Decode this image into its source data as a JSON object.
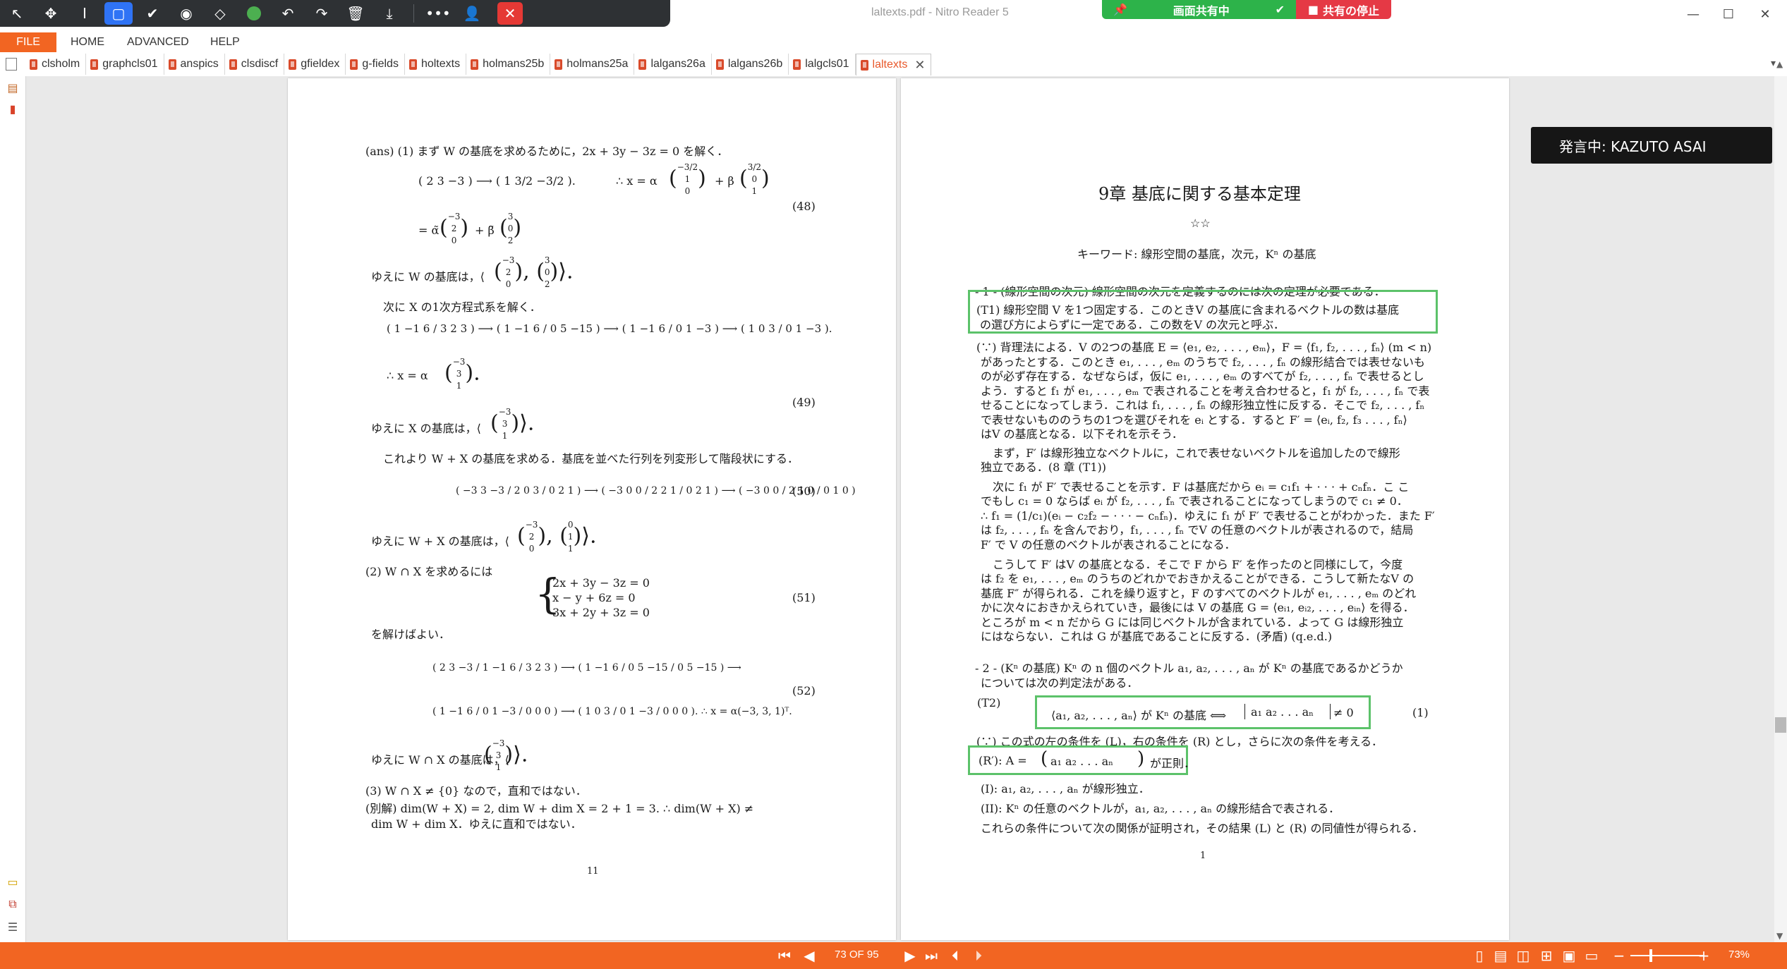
{
  "window": {
    "title": "laltexts.pdf - Nitro Reader 5",
    "share_status": "画面共有中",
    "share_stop": "共有の停止",
    "minimize": "—",
    "maximize": "☐",
    "close": "✕"
  },
  "menu": {
    "items": [
      "FILE",
      "HOME",
      "ADVANCED",
      "HELP"
    ]
  },
  "tabs": [
    {
      "label": "clsholm"
    },
    {
      "label": "graphcls01"
    },
    {
      "label": "anspics"
    },
    {
      "label": "clsdiscf"
    },
    {
      "label": "gfieldex"
    },
    {
      "label": "g-fields"
    },
    {
      "label": "holtexts"
    },
    {
      "label": "holmans25b"
    },
    {
      "label": "holmans25a"
    },
    {
      "label": "lalgans26a"
    },
    {
      "label": "lalgans26b"
    },
    {
      "label": "lalgcls01"
    },
    {
      "label": "laltexts",
      "active": true
    }
  ],
  "speaking_badge": "発言中: KAZUTO ASAI",
  "left_page": {
    "l1": "(ans) (1) まず W の基底を求めるために，2x + 3y − 3z = 0 を解く．",
    "l2a": "( 2  3  −3 ) ⟶ ( 1  3/2  −3/2 ).",
    "l2b": "∴  x = α",
    "l2c": "+ β",
    "eq48": "(48)",
    "l3": "= α̃",
    "l3b": "+ β̃",
    "l4": "ゆえに W の基底は，⟨",
    "l5": "次に X の1次方程式系を解く．",
    "l6": "∴  x = α",
    "eq49": "(49)",
    "l7": "ゆえに X の基底は，⟨",
    "l8": "これより W + X の基底を求める．基底を並べた行列を列変形して階段状にする．",
    "eq50": "(50)",
    "l9": "ゆえに W + X の基底は，⟨",
    "l10": "(2) W ∩ X を求めるには",
    "sys1": "2x + 3y − 3z = 0",
    "sys2": "x − y + 6z = 0",
    "sys3": "3x + 2y + 3z = 0",
    "eq51": "(51)",
    "l11": "を解けばよい．",
    "eq52": "(52)",
    "l12": "ゆえに W ∩ X の基底は，⟨",
    "l13": "(3) W ∩ X ≠ {0} なので，直和ではない．",
    "l14": "(別解) dim(W + X) = 2,  dim W + dim X = 2 + 1 = 3.    ∴  dim(W + X) ≠",
    "l15": "dim W + dim X．ゆえに直和ではない．",
    "page_no": "11"
  },
  "right_page": {
    "chapter": "9章  基底に関する基本定理",
    "stars": "☆☆",
    "keywords": "キーワード: 線形空間の基底，次元，Kⁿ の基底",
    "sec1": "- 1 - (線形空間の次元) 線形空間の次元を定義するのには次の定理が必要である．",
    "t1a": "(T1) 線形空間 V を1つ固定する．このときV の基底に含まれるベクトルの数は基底",
    "t1b": "の選び方によらずに一定である．この数をV の次元と呼ぶ．",
    "p1": "(∵) 背理法による．V の2つの基底 E = ⟨e₁, e₂, . . . , eₘ⟩，F = ⟨f₁, f₂, . . . , fₙ⟩ (m < n)",
    "p2": "があったとする．このとき e₁, . . . , eₘ のうちで f₂, . . . , fₙ の線形結合では表せないも",
    "p3": "のが必ず存在する．なぜならば，仮に e₁, . . . , eₘ のすべてが f₂, . . . , fₙ で表せるとし",
    "p4": "よう．すると f₁ が e₁, . . . , eₘ で表されることを考え合わせると，f₁ が f₂, . . . , fₙ で表",
    "p5": "せることになってしまう．これは f₁, . . . , fₙ の線形独立性に反する．そこで f₂, . . . , fₙ",
    "p6": "で表せないもののうちの1つを選びそれを eᵢ とする．すると F′ = ⟨eᵢ, f₂, f₃ . . . , fₙ⟩",
    "p7": "はV の基底となる．以下それを示そう．",
    "p8": "まず，F′ は線形独立なベクトルに，これで表せないベクトルを追加したので線形",
    "p9": "独立である．(8 章 (T1))",
    "p10": "次に f₁ が F′ で表せることを示す．F は基底だから eᵢ = c₁f₁ + · · · + cₙfₙ．こ こ",
    "p11": "でもし c₁ = 0 ならば eᵢ が f₂, . . . , fₙ で表されることになってしまうので c₁ ≠ 0．",
    "p12": "∴ f₁ = (1/c₁)(eᵢ − c₂f₂ − · · · − cₙfₙ)．ゆえに f₁ が F′ で表せることがわかった．また F′",
    "p13": "は f₂, . . . , fₙ を含んでおり，f₁, . . . , fₙ でV の任意のベクトルが表されるので，結局",
    "p14": "F′ で V の任意のベクトルが表されることになる．",
    "p15": "こうして F′ はV の基底となる．そこで F から F′ を作ったのと同様にして，今度",
    "p16": "は f₂ を e₁, . . . , eₘ のうちのどれかでおきかえることができる．こうして新たなV の",
    "p17": "基底 F″ が得られる．これを繰り返すと，F のすべてのベクトルが e₁, . . . , eₘ のどれ",
    "p18": "かに次々におきかえられていき，最後には V の基底 G = ⟨eᵢ₁, eᵢ₂, . . . , eᵢₙ⟩ を得る．",
    "p19": "ところが m < n だから G には同じベクトルが含まれている．よって G は線形独立",
    "p20": "にはならない．これは G が基底であることに反する．(矛盾)    (q.e.d.)",
    "sec2a": "- 2 - (Kⁿ の基底) Kⁿ の n 個のベクトル a₁, a₂, . . . , aₙ が Kⁿ の基底であるかどうか",
    "sec2b": "については次の判定法がある．",
    "t2": "(T2)",
    "t2formula": "⟨a₁, a₂, . . . , aₙ⟩ が Kⁿ の基底  ⟺",
    "t2det": "a₁   a₂   . . .   aₙ",
    "t2ne": "≠ 0",
    "t2num": "(1)",
    "r1": "(∵) この式の左の条件を (L)，右の条件を (R) とし，さらに次の条件を考える．",
    "r2": "(R′): A =",
    "r2mat": "a₁   a₂   . . .   aₙ",
    "r2end": "が正則．",
    "r3": "(I): a₁, a₂, . . . , aₙ が線形独立．",
    "r4": "(II): Kⁿ の任意のベクトルが，a₁, a₂, . . . , aₙ の線形結合で表される．",
    "r5": "これらの条件について次の関係が証明され，その結果 (L) と (R) の同値性が得られる．",
    "page_no": "1"
  },
  "status": {
    "page_indicator": "73 OF 95",
    "zoom": "73%"
  },
  "colors": {
    "accent": "#f26522",
    "annotation_box": "#5cc26a",
    "share_green": "#2db34a",
    "share_red": "#e53945"
  }
}
